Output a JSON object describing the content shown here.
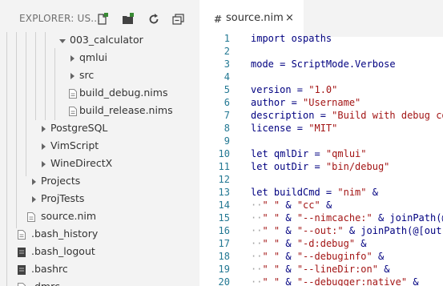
{
  "explorer": {
    "title": "EXPLORER: US...",
    "toolbar": [
      "new-file-icon",
      "new-folder-icon",
      "refresh-icon",
      "collapse-all-icon"
    ]
  },
  "tree": [
    {
      "label": "003_calculator",
      "kind": "folder",
      "expanded": true,
      "depth": 3
    },
    {
      "label": "qmlui",
      "kind": "folder",
      "expanded": false,
      "depth": 4
    },
    {
      "label": "src",
      "kind": "folder",
      "expanded": false,
      "depth": 4
    },
    {
      "label": "build_debug.nims",
      "kind": "file",
      "depth": 4
    },
    {
      "label": "build_release.nims",
      "kind": "file",
      "depth": 4
    },
    {
      "label": "PostgreSQL",
      "kind": "folder",
      "expanded": false,
      "depth": 2
    },
    {
      "label": "VimScript",
      "kind": "folder",
      "expanded": false,
      "depth": 2
    },
    {
      "label": "WineDirectX",
      "kind": "folder",
      "expanded": false,
      "depth": 2
    },
    {
      "label": "Projects",
      "kind": "folder",
      "expanded": false,
      "depth": 1
    },
    {
      "label": "ProjTests",
      "kind": "folder",
      "expanded": false,
      "depth": 1
    },
    {
      "label": "source.nim",
      "kind": "file",
      "depth": 1
    },
    {
      "label": ".bash_history",
      "kind": "file",
      "depth": 0
    },
    {
      "label": ".bash_logout",
      "kind": "file-dark",
      "depth": 0
    },
    {
      "label": ".bashrc",
      "kind": "file-dark",
      "depth": 0
    },
    {
      "label": ".dmrc",
      "kind": "file",
      "depth": 0
    }
  ],
  "tab": {
    "label": "source.nim",
    "icon": "#",
    "close": "×"
  },
  "code": [
    {
      "n": "1",
      "segs": [
        [
          "import ospaths",
          "p"
        ]
      ]
    },
    {
      "n": "2",
      "segs": []
    },
    {
      "n": "3",
      "segs": [
        [
          "mode = ScriptMode.Verbose",
          "p"
        ]
      ]
    },
    {
      "n": "4",
      "segs": []
    },
    {
      "n": "5",
      "segs": [
        [
          "version = ",
          "p"
        ],
        [
          "\"1.0\"",
          "s"
        ]
      ]
    },
    {
      "n": "6",
      "segs": [
        [
          "author = ",
          "p"
        ],
        [
          "\"Username\"",
          "s"
        ]
      ]
    },
    {
      "n": "7",
      "segs": [
        [
          "description = ",
          "p"
        ],
        [
          "\"Build with debug co",
          "s"
        ]
      ]
    },
    {
      "n": "8",
      "segs": [
        [
          "license = ",
          "p"
        ],
        [
          "\"MIT\"",
          "s"
        ]
      ]
    },
    {
      "n": "9",
      "segs": []
    },
    {
      "n": "10",
      "segs": [
        [
          "let qmlDir = ",
          "p"
        ],
        [
          "\"qmlui\"",
          "s"
        ]
      ]
    },
    {
      "n": "11",
      "segs": [
        [
          "let outDir = ",
          "p"
        ],
        [
          "\"bin/debug\"",
          "s"
        ]
      ]
    },
    {
      "n": "12",
      "segs": []
    },
    {
      "n": "13",
      "segs": [
        [
          "let buildCmd = ",
          "p"
        ],
        [
          "\"nim\"",
          "s"
        ],
        [
          " &",
          "p"
        ]
      ]
    },
    {
      "n": "14",
      "segs": [
        [
          "··",
          "w"
        ],
        [
          "\" \"",
          "s"
        ],
        [
          " & ",
          "p"
        ],
        [
          "\"cc\"",
          "s"
        ],
        [
          " &",
          "p"
        ]
      ]
    },
    {
      "n": "15",
      "segs": [
        [
          "··",
          "w"
        ],
        [
          "\" \"",
          "s"
        ],
        [
          " & ",
          "p"
        ],
        [
          "\"--nimcache:\"",
          "s"
        ],
        [
          " & joinPath(@",
          "p"
        ]
      ]
    },
    {
      "n": "16",
      "segs": [
        [
          "··",
          "w"
        ],
        [
          "\" \"",
          "s"
        ],
        [
          " & ",
          "p"
        ],
        [
          "\"--out:\"",
          "s"
        ],
        [
          " & joinPath(@[out",
          "p"
        ]
      ]
    },
    {
      "n": "17",
      "segs": [
        [
          "··",
          "w"
        ],
        [
          "\" \"",
          "s"
        ],
        [
          " & ",
          "p"
        ],
        [
          "\"-d:debug\"",
          "s"
        ],
        [
          " &",
          "p"
        ]
      ]
    },
    {
      "n": "18",
      "segs": [
        [
          "··",
          "w"
        ],
        [
          "\" \"",
          "s"
        ],
        [
          " & ",
          "p"
        ],
        [
          "\"--debuginfo\"",
          "s"
        ],
        [
          " &",
          "p"
        ]
      ]
    },
    {
      "n": "19",
      "segs": [
        [
          "··",
          "w"
        ],
        [
          "\" \"",
          "s"
        ],
        [
          " & ",
          "p"
        ],
        [
          "\"--lineDir:on\"",
          "s"
        ],
        [
          " &",
          "p"
        ]
      ]
    },
    {
      "n": "20",
      "segs": [
        [
          "··",
          "w"
        ],
        [
          "\" \"",
          "s"
        ],
        [
          " & ",
          "p"
        ],
        [
          "\"--debugger:native\"",
          "s"
        ],
        [
          " &",
          "p"
        ]
      ]
    }
  ],
  "colors": {
    "sidebar_bg": "#f3f3f3",
    "line_number": "#237893",
    "string": "#a31515",
    "plain": "#000080"
  }
}
